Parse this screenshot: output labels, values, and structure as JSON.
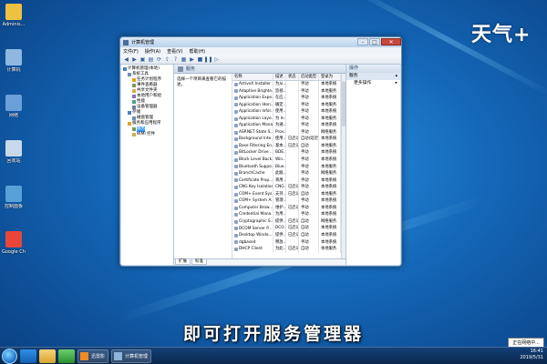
{
  "desktop": {
    "icons": [
      {
        "label": "Adminis...",
        "icon": "user-folder-icon",
        "color": "#f0c040"
      },
      {
        "label": "计算机",
        "icon": "computer-icon",
        "color": "#8fb8e0"
      },
      {
        "label": "网络",
        "icon": "network-icon",
        "color": "#6aa0d8"
      },
      {
        "label": "回收站",
        "icon": "recycle-bin-icon",
        "color": "#c8d8e8"
      },
      {
        "label": "控制面板",
        "icon": "control-panel-icon",
        "color": "#58a0d8"
      },
      {
        "label": "Google Chrome",
        "icon": "chrome-icon",
        "color": "#e8463a"
      }
    ]
  },
  "watermark": "天气+",
  "window": {
    "title": "计算机管理",
    "menu": [
      "文件(F)",
      "操作(A)",
      "查看(V)",
      "帮助(H)"
    ],
    "tree": [
      {
        "label": "计算机管理(本地)",
        "indent": 0,
        "selected": false
      },
      {
        "label": "系统工具",
        "indent": 1,
        "selected": false
      },
      {
        "label": "任务计划程序",
        "indent": 2,
        "selected": false
      },
      {
        "label": "事件查看器",
        "indent": 2,
        "selected": false
      },
      {
        "label": "共享文件夹",
        "indent": 2,
        "selected": false
      },
      {
        "label": "本地用户和组",
        "indent": 2,
        "selected": false
      },
      {
        "label": "性能",
        "indent": 2,
        "selected": false
      },
      {
        "label": "设备管理器",
        "indent": 2,
        "selected": false
      },
      {
        "label": "存储",
        "indent": 1,
        "selected": false
      },
      {
        "label": "磁盘管理",
        "indent": 2,
        "selected": false
      },
      {
        "label": "服务和应用程序",
        "indent": 1,
        "selected": false
      },
      {
        "label": "服务",
        "indent": 2,
        "selected": true
      },
      {
        "label": "WMI 控件",
        "indent": 2,
        "selected": false
      }
    ],
    "pane_title": "服务",
    "description": "选择一个项目来查看它的描述。",
    "columns": [
      "名称",
      "描述",
      "状态",
      "启动类型",
      "登录为"
    ],
    "rows": [
      [
        "ActiveX Installer ...",
        "为从...",
        "",
        "手动",
        "本地系统"
      ],
      [
        "Adaptive Brightn...",
        "监视...",
        "",
        "手动",
        "本地服务"
      ],
      [
        "Application Expe...",
        "在应...",
        "",
        "手动",
        "本地系统"
      ],
      [
        "Application Iden...",
        "确定...",
        "",
        "手动",
        "本地服务"
      ],
      [
        "Application Infor...",
        "使用...",
        "",
        "手动",
        "本地系统"
      ],
      [
        "Application Laye...",
        "为 In...",
        "",
        "手动",
        "本地服务"
      ],
      [
        "Application Mana...",
        "为通...",
        "",
        "手动",
        "本地系统"
      ],
      [
        "ASP.NET State S...",
        "Prov...",
        "",
        "手动",
        "网络服务"
      ],
      [
        "Background Inte...",
        "使用...",
        "已启动",
        "自动(延迟...",
        "本地系统"
      ],
      [
        "Base Filtering En...",
        "基本...",
        "已启动",
        "自动",
        "本地服务"
      ],
      [
        "BitLocker Drive ...",
        "BDE...",
        "",
        "手动",
        "本地系统"
      ],
      [
        "Block Level Back...",
        "Win...",
        "",
        "手动",
        "本地系统"
      ],
      [
        "Bluetooth Suppo...",
        "Blue...",
        "",
        "手动",
        "本地服务"
      ],
      [
        "BranchCache",
        "此服...",
        "",
        "手动",
        "网络服务"
      ],
      [
        "Certificate Prop...",
        "将用...",
        "",
        "手动",
        "本地系统"
      ],
      [
        "CNG Key Isolation",
        "CNG...",
        "已启动",
        "手动",
        "本地系统"
      ],
      [
        "COM+ Event Sys...",
        "支持...",
        "已启动",
        "自动",
        "本地服务"
      ],
      [
        "COM+ System A...",
        "管理...",
        "",
        "手动",
        "本地系统"
      ],
      [
        "Computer Brow...",
        "维护...",
        "已启动",
        "手动",
        "本地系统"
      ],
      [
        "Credential Mana...",
        "为用...",
        "",
        "手动",
        "本地系统"
      ],
      [
        "Cryptographic S...",
        "提供...",
        "已启动",
        "自动",
        "网络服务"
      ],
      [
        "DCOM Server P...",
        "DCO...",
        "已启动",
        "自动",
        "本地系统"
      ],
      [
        "Desktop Windo...",
        "提供...",
        "已启动",
        "自动",
        "本地系统"
      ],
      [
        "dgbased",
        "释放...",
        "",
        "手动",
        "本地系统"
      ],
      [
        "DHCP Client",
        "为此...",
        "已启动",
        "自动",
        "本地服务"
      ]
    ],
    "tabs": [
      "扩展",
      "标准"
    ],
    "actions": {
      "header": "操作",
      "group": "服务",
      "items": [
        "更多操作"
      ]
    }
  },
  "subtitle": "即可打开服务管理器",
  "taskbar": {
    "tasks": [
      {
        "label": "迅雷影",
        "icon": "media-player-icon",
        "color": "#f08a24"
      },
      {
        "label": "计算机管理",
        "icon": "computer-management-icon",
        "color": "#8fb3d9"
      }
    ],
    "time": "16:41",
    "date": "2019/5/31",
    "tooltip": "正在网络中..."
  }
}
